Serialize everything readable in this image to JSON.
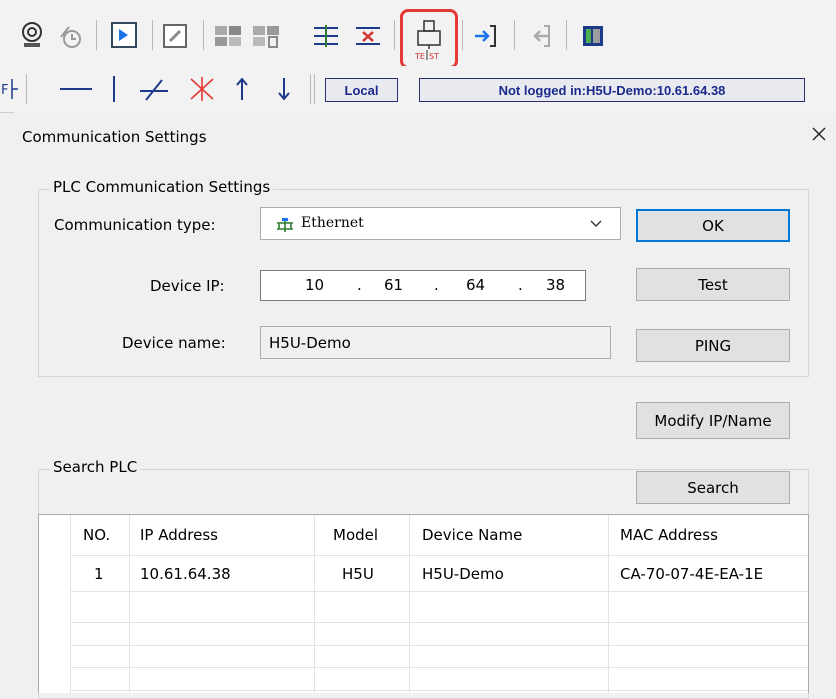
{
  "toolbar": {
    "row1_icons": [
      "monitor-icon",
      "clock-icon",
      "play-step-icon",
      "edit-icon",
      "grid-compare-icon",
      "grid-delete-icon",
      "align-icon",
      "align-delete-icon",
      "test-connection-icon",
      "download-to-plc-icon",
      "upload-from-plc-icon",
      "module-icon"
    ],
    "row2_icons": [
      "f-bracket-icon",
      "horizontal-line-icon",
      "vertical-line-icon",
      "diagonal-line-icon",
      "cross-delete-icon",
      "arrow-up-icon",
      "arrow-down-icon"
    ],
    "local_label": "Local",
    "status_text": "Not logged in:H5U-Demo:10.61.64.38",
    "highlight_color": "#e53935"
  },
  "dialog": {
    "title": "Communication Settings",
    "plc_group_label": "PLC Communication Settings",
    "comm_type_label": "Communication type:",
    "comm_type_value": "Ethernet",
    "device_ip_label": "Device IP:",
    "ip_octets": [
      "10",
      "61",
      "64",
      "38"
    ],
    "ip_dot": ".",
    "device_name_label": "Device name:",
    "device_name_value": "H5U-Demo",
    "ok_label": "OK",
    "test_label": "Test",
    "ping_label": "PING",
    "modify_label": "Modify IP/Name",
    "search_group_label": "Search PLC",
    "search_label": "Search",
    "table": {
      "columns": [
        "NO.",
        "IP Address",
        "Model",
        "Device Name",
        "MAC Address"
      ],
      "rows": [
        [
          "1",
          "10.61.64.38",
          "H5U",
          "H5U-Demo",
          "CA-70-07-4E-EA-1E"
        ]
      ]
    }
  }
}
